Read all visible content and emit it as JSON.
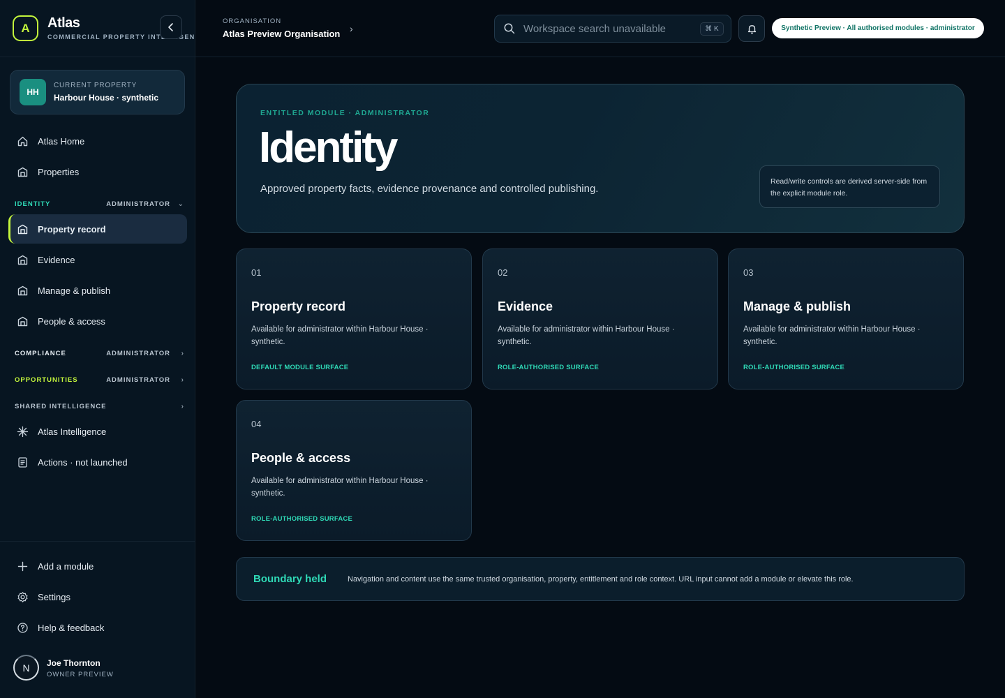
{
  "app": {
    "name": "Atlas",
    "subtitle": "COMMERCIAL PROPERTY INTELLIGENCE",
    "logo_letter": "A",
    "accent": "#c3f53c",
    "teal": "#2fd9b6"
  },
  "current_property": {
    "initials": "HH",
    "label": "CURRENT PROPERTY",
    "name": "Harbour House · synthetic"
  },
  "sidebar": {
    "top_items": [
      {
        "label": "Atlas Home",
        "icon": "home-icon"
      },
      {
        "label": "Properties",
        "icon": "building-icon"
      }
    ],
    "identity_section": {
      "name": "IDENTITY",
      "role": "ADMINISTRATOR",
      "chevron": "chevron-down-icon",
      "color": "#2fd9b6"
    },
    "identity_items": [
      {
        "label": "Property record",
        "icon": "building-icon",
        "active": true
      },
      {
        "label": "Evidence",
        "icon": "building-icon"
      },
      {
        "label": "Manage & publish",
        "icon": "building-icon"
      },
      {
        "label": "People & access",
        "icon": "building-icon"
      }
    ],
    "compliance_section": {
      "name": "COMPLIANCE",
      "role": "ADMINISTRATOR",
      "color": "#e6edf3"
    },
    "opportunities_section": {
      "name": "OPPORTUNITIES",
      "role": "ADMINISTRATOR",
      "color": "#c3f53c"
    },
    "shared_section": {
      "name": "SHARED INTELLIGENCE",
      "color": "#b8c4cf"
    },
    "shared_items": [
      {
        "label": "Atlas Intelligence",
        "icon": "sparkle-icon"
      },
      {
        "label": "Actions · not launched",
        "icon": "document-icon"
      }
    ],
    "bottom_items": [
      {
        "label": "Add a module",
        "icon": "plus-icon"
      },
      {
        "label": "Settings",
        "icon": "gear-icon"
      },
      {
        "label": "Help & feedback",
        "icon": "help-icon"
      }
    ],
    "user": {
      "initial": "N",
      "name": "Joe Thornton",
      "role": "OWNER PREVIEW"
    }
  },
  "topbar": {
    "org_label": "ORGANISATION",
    "org_name": "Atlas Preview Organisation",
    "search_placeholder": "Workspace search unavailable",
    "search_shortcut": "⌘ K",
    "preview_badge": "Synthetic Preview · All authorised modules · administrator"
  },
  "hero": {
    "eyebrow": "ENTITLED MODULE · ADMINISTRATOR",
    "title": "Identity",
    "description": "Approved property facts, evidence provenance and controlled publishing.",
    "note": "Read/write controls are derived server-side from the explicit module role."
  },
  "modules": [
    {
      "num": "01",
      "title": "Property record",
      "desc": "Available for administrator within Harbour House · synthetic.",
      "tag": "DEFAULT MODULE SURFACE"
    },
    {
      "num": "02",
      "title": "Evidence",
      "desc": "Available for administrator within Harbour House · synthetic.",
      "tag": "ROLE-AUTHORISED SURFACE"
    },
    {
      "num": "03",
      "title": "Manage & publish",
      "desc": "Available for administrator within Harbour House · synthetic.",
      "tag": "ROLE-AUTHORISED SURFACE"
    },
    {
      "num": "04",
      "title": "People & access",
      "desc": "Available for administrator within Harbour House · synthetic.",
      "tag": "ROLE-AUTHORISED SURFACE"
    }
  ],
  "boundary": {
    "title": "Boundary held",
    "text": "Navigation and content use the same trusted organisation, property, entitlement and role context. URL input cannot add a module or elevate this role."
  }
}
